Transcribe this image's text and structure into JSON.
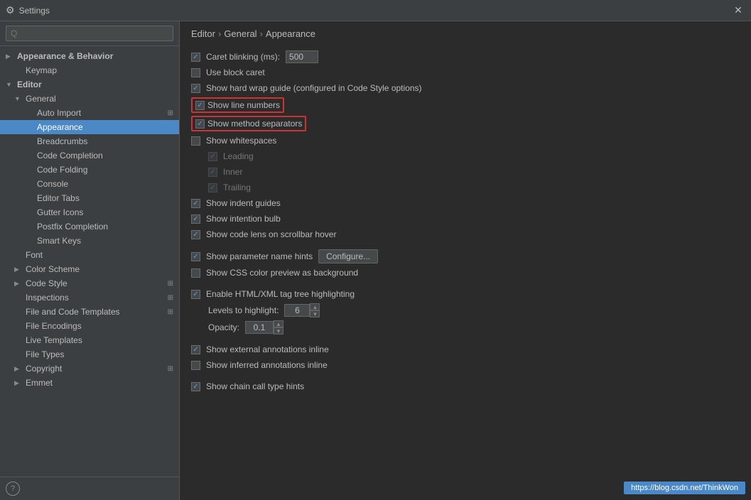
{
  "window": {
    "title": "Settings",
    "icon": "⚙"
  },
  "sidebar": {
    "search_placeholder": "Q",
    "items": [
      {
        "id": "appearance-behavior",
        "label": "Appearance & Behavior",
        "indent": 0,
        "arrow": "▶",
        "bold": true
      },
      {
        "id": "keymap",
        "label": "Keymap",
        "indent": 1,
        "arrow": ""
      },
      {
        "id": "editor",
        "label": "Editor",
        "indent": 0,
        "arrow": "▼",
        "bold": true
      },
      {
        "id": "general",
        "label": "General",
        "indent": 1,
        "arrow": "▼"
      },
      {
        "id": "auto-import",
        "label": "Auto Import",
        "indent": 2,
        "arrow": "",
        "icon_right": "⊞"
      },
      {
        "id": "appearance",
        "label": "Appearance",
        "indent": 2,
        "arrow": "",
        "selected": true
      },
      {
        "id": "breadcrumbs",
        "label": "Breadcrumbs",
        "indent": 2,
        "arrow": ""
      },
      {
        "id": "code-completion",
        "label": "Code Completion",
        "indent": 2,
        "arrow": ""
      },
      {
        "id": "code-folding",
        "label": "Code Folding",
        "indent": 2,
        "arrow": ""
      },
      {
        "id": "console",
        "label": "Console",
        "indent": 2,
        "arrow": ""
      },
      {
        "id": "editor-tabs",
        "label": "Editor Tabs",
        "indent": 2,
        "arrow": ""
      },
      {
        "id": "gutter-icons",
        "label": "Gutter Icons",
        "indent": 2,
        "arrow": ""
      },
      {
        "id": "postfix-completion",
        "label": "Postfix Completion",
        "indent": 2,
        "arrow": ""
      },
      {
        "id": "smart-keys",
        "label": "Smart Keys",
        "indent": 2,
        "arrow": ""
      },
      {
        "id": "font",
        "label": "Font",
        "indent": 1,
        "arrow": ""
      },
      {
        "id": "color-scheme",
        "label": "Color Scheme",
        "indent": 1,
        "arrow": "▶"
      },
      {
        "id": "code-style",
        "label": "Code Style",
        "indent": 1,
        "arrow": "▶",
        "icon_right": "⊞"
      },
      {
        "id": "inspections",
        "label": "Inspections",
        "indent": 1,
        "arrow": "",
        "icon_right": "⊞"
      },
      {
        "id": "file-code-templates",
        "label": "File and Code Templates",
        "indent": 1,
        "arrow": "",
        "icon_right": "⊞"
      },
      {
        "id": "file-encodings",
        "label": "File Encodings",
        "indent": 1,
        "arrow": ""
      },
      {
        "id": "live-templates",
        "label": "Live Templates",
        "indent": 1,
        "arrow": ""
      },
      {
        "id": "file-types",
        "label": "File Types",
        "indent": 1,
        "arrow": ""
      },
      {
        "id": "copyright",
        "label": "Copyright",
        "indent": 1,
        "arrow": "▶",
        "icon_right": "⊞"
      },
      {
        "id": "emmet",
        "label": "Emmet",
        "indent": 1,
        "arrow": "▶"
      }
    ],
    "help_label": "?"
  },
  "breadcrumb": {
    "parts": [
      "Editor",
      "General",
      "Appearance"
    ],
    "separator": "›"
  },
  "settings": {
    "caret_blinking": {
      "label": "Caret blinking (ms):",
      "checked": true,
      "value": "500"
    },
    "use_block_caret": {
      "label": "Use block caret",
      "checked": false
    },
    "show_hard_wrap": {
      "label": "Show hard wrap guide (configured in Code Style options)",
      "checked": true
    },
    "show_line_numbers": {
      "label": "Show line numbers",
      "checked": true,
      "highlighted": true
    },
    "show_method_separators": {
      "label": "Show method separators",
      "checked": true,
      "highlighted": true
    },
    "show_whitespaces": {
      "label": "Show whitespaces",
      "checked": false
    },
    "leading": {
      "label": "Leading",
      "checked": true,
      "disabled": true
    },
    "inner": {
      "label": "Inner",
      "checked": true,
      "disabled": true
    },
    "trailing": {
      "label": "Trailing",
      "checked": true,
      "disabled": true
    },
    "show_indent_guides": {
      "label": "Show indent guides",
      "checked": true
    },
    "show_intention_bulb": {
      "label": "Show intention bulb",
      "checked": true
    },
    "show_code_lens": {
      "label": "Show code lens on scrollbar hover",
      "checked": true
    },
    "show_parameter_hints": {
      "label": "Show parameter name hints",
      "checked": true,
      "configure_btn": "Configure..."
    },
    "show_css_color": {
      "label": "Show CSS color preview as background",
      "checked": false
    },
    "enable_html_xml": {
      "label": "Enable HTML/XML tag tree highlighting",
      "checked": true
    },
    "levels_to_highlight": {
      "label": "Levels to highlight:",
      "value": "6"
    },
    "opacity": {
      "label": "Opacity:",
      "value": "0.1"
    },
    "show_external_annotations": {
      "label": "Show external annotations inline",
      "checked": true
    },
    "show_inferred_annotations": {
      "label": "Show inferred annotations inline",
      "checked": false
    },
    "show_chain_call": {
      "label": "Show chain call type hints",
      "checked": true
    }
  },
  "url_bar": {
    "text": "https://blog.csdn.net/ThinkWon"
  }
}
